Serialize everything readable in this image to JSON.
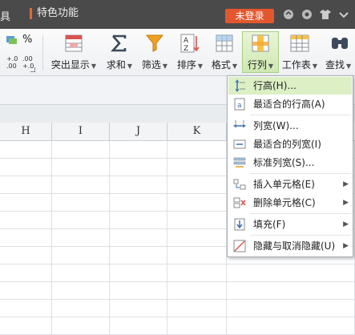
{
  "titlebar": {
    "left_text": "具",
    "feature_label": "特色功能",
    "login_label": "未登录",
    "icons": [
      "refresh-icon",
      "help-icon",
      "shirt-icon",
      "minimize-icon"
    ]
  },
  "ribbon": {
    "number_format": {
      "percent": "%",
      "inc_decimal": "+.0 .00",
      "dec_decimal": ".00 +.0"
    },
    "buttons": [
      {
        "label": "突出显示",
        "icon": "highlight-icon",
        "dropdown": true
      },
      {
        "label": "求和",
        "icon": "sum-icon",
        "dropdown": true
      },
      {
        "label": "筛选",
        "icon": "filter-icon",
        "dropdown": true
      },
      {
        "label": "排序",
        "icon": "sort-icon",
        "dropdown": true
      },
      {
        "label": "格式",
        "icon": "format-icon",
        "dropdown": true
      },
      {
        "label": "行列",
        "icon": "row-column-icon",
        "dropdown": true,
        "active": true
      },
      {
        "label": "工作表",
        "icon": "worksheet-icon",
        "dropdown": true
      },
      {
        "label": "查找",
        "icon": "find-icon",
        "dropdown": true
      }
    ]
  },
  "grid": {
    "columns": [
      "H",
      "I",
      "J",
      "K"
    ]
  },
  "menu": {
    "items": [
      {
        "label": "行高(H)...",
        "icon": "row-height-icon",
        "submenu": false,
        "highlighted": true
      },
      {
        "label": "最适合的行高(A)",
        "icon": "autofit-row-height-icon",
        "submenu": false
      },
      {
        "label": "列宽(W)...",
        "icon": "column-width-icon",
        "submenu": false
      },
      {
        "label": "最适合的列宽(I)",
        "icon": "autofit-column-width-icon",
        "submenu": false
      },
      {
        "label": "标准列宽(S)...",
        "icon": "standard-column-width-icon",
        "submenu": false
      },
      {
        "label": "插入单元格(E)",
        "icon": "insert-cells-icon",
        "submenu": true
      },
      {
        "label": "删除单元格(C)",
        "icon": "delete-cells-icon",
        "submenu": true
      },
      {
        "label": "填充(F)",
        "icon": "fill-icon",
        "submenu": true
      },
      {
        "label": "隐藏与取消隐藏(U)",
        "icon": "hide-unhide-icon",
        "submenu": true
      }
    ]
  },
  "colors": {
    "accent_orange": "#e3572f",
    "active_green": "#cfe8b2",
    "titlebar": "#4a4a4a"
  }
}
